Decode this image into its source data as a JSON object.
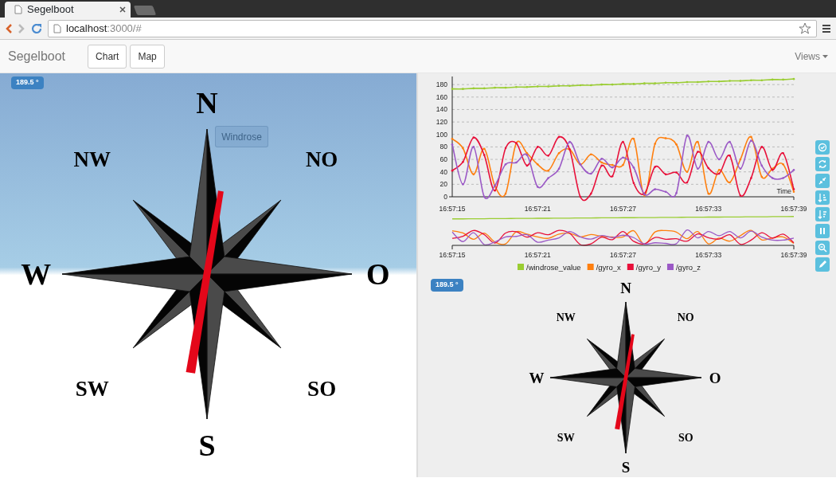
{
  "browser": {
    "tab_title": "Segelboot",
    "url": {
      "host": "localhost",
      "rest": ":3000/#"
    }
  },
  "navbar": {
    "brand": "Segelboot",
    "buttons": [
      "Chart",
      "Map"
    ],
    "menu": "Views"
  },
  "windrose_main": {
    "badge": "189.5 °",
    "button": "Windrose",
    "labels": [
      "N",
      "NO",
      "O",
      "SO",
      "S",
      "SW",
      "W",
      "NW"
    ]
  },
  "chart_panel": {
    "chart_data": {
      "type": "line",
      "xlabel": "Time",
      "categories": [
        "16:57:15",
        null,
        null,
        null,
        null,
        null,
        null,
        null,
        "16:57:21",
        null,
        null,
        null,
        null,
        null,
        null,
        null,
        "16:57:27",
        null,
        null,
        null,
        null,
        null,
        null,
        null,
        "16:57:33",
        null,
        null,
        null,
        null,
        null,
        null,
        null,
        "16:57:39"
      ],
      "yticks": [
        0,
        20,
        40,
        60,
        80,
        100,
        120,
        140,
        160,
        180
      ],
      "ylim": [
        0,
        193
      ],
      "grid": true,
      "legend": "bottom",
      "series": [
        {
          "name": "/windrose_value",
          "color": "#9acd32",
          "values": [
            173,
            173,
            174,
            174,
            175,
            175,
            176,
            176,
            177,
            177,
            178,
            178,
            179,
            179,
            180,
            180,
            181,
            181,
            182,
            182,
            183,
            183,
            184,
            184,
            185,
            185,
            186,
            186,
            187,
            187,
            188,
            188,
            189
          ]
        },
        {
          "name": "/gyro_x",
          "color": "#ff7f0e",
          "values": [
            93,
            78,
            36,
            77,
            17,
            5,
            86,
            70,
            52,
            42,
            70,
            76,
            52,
            68,
            55,
            51,
            51,
            93,
            2,
            85,
            94,
            84,
            40,
            88,
            5,
            43,
            23,
            60,
            96,
            32,
            45,
            52,
            8
          ]
        },
        {
          "name": "/gyro_y",
          "color": "#e8103a",
          "values": [
            42,
            56,
            95,
            67,
            10,
            78,
            86,
            50,
            80,
            66,
            96,
            76,
            0,
            5,
            50,
            33,
            88,
            22,
            5,
            48,
            36,
            39,
            23,
            72,
            46,
            37,
            66,
            2,
            30,
            80,
            43,
            70,
            12
          ]
        },
        {
          "name": "/gyro_z",
          "color": "#9b59c6",
          "values": [
            84,
            20,
            80,
            0,
            18,
            52,
            55,
            67,
            16,
            30,
            45,
            88,
            52,
            37,
            61,
            47,
            63,
            47,
            4,
            12,
            8,
            6,
            98,
            45,
            88,
            60,
            88,
            45,
            90,
            50,
            30,
            30,
            43
          ]
        }
      ]
    },
    "overview_xticks": [
      "16:57:15",
      "16:57:21",
      "16:57:27",
      "16:57:33",
      "16:57:39"
    ]
  },
  "windrose_small": {
    "badge": "189.5 °",
    "labels": [
      "N",
      "NO",
      "O",
      "SO",
      "S",
      "SW",
      "W",
      "NW"
    ]
  }
}
